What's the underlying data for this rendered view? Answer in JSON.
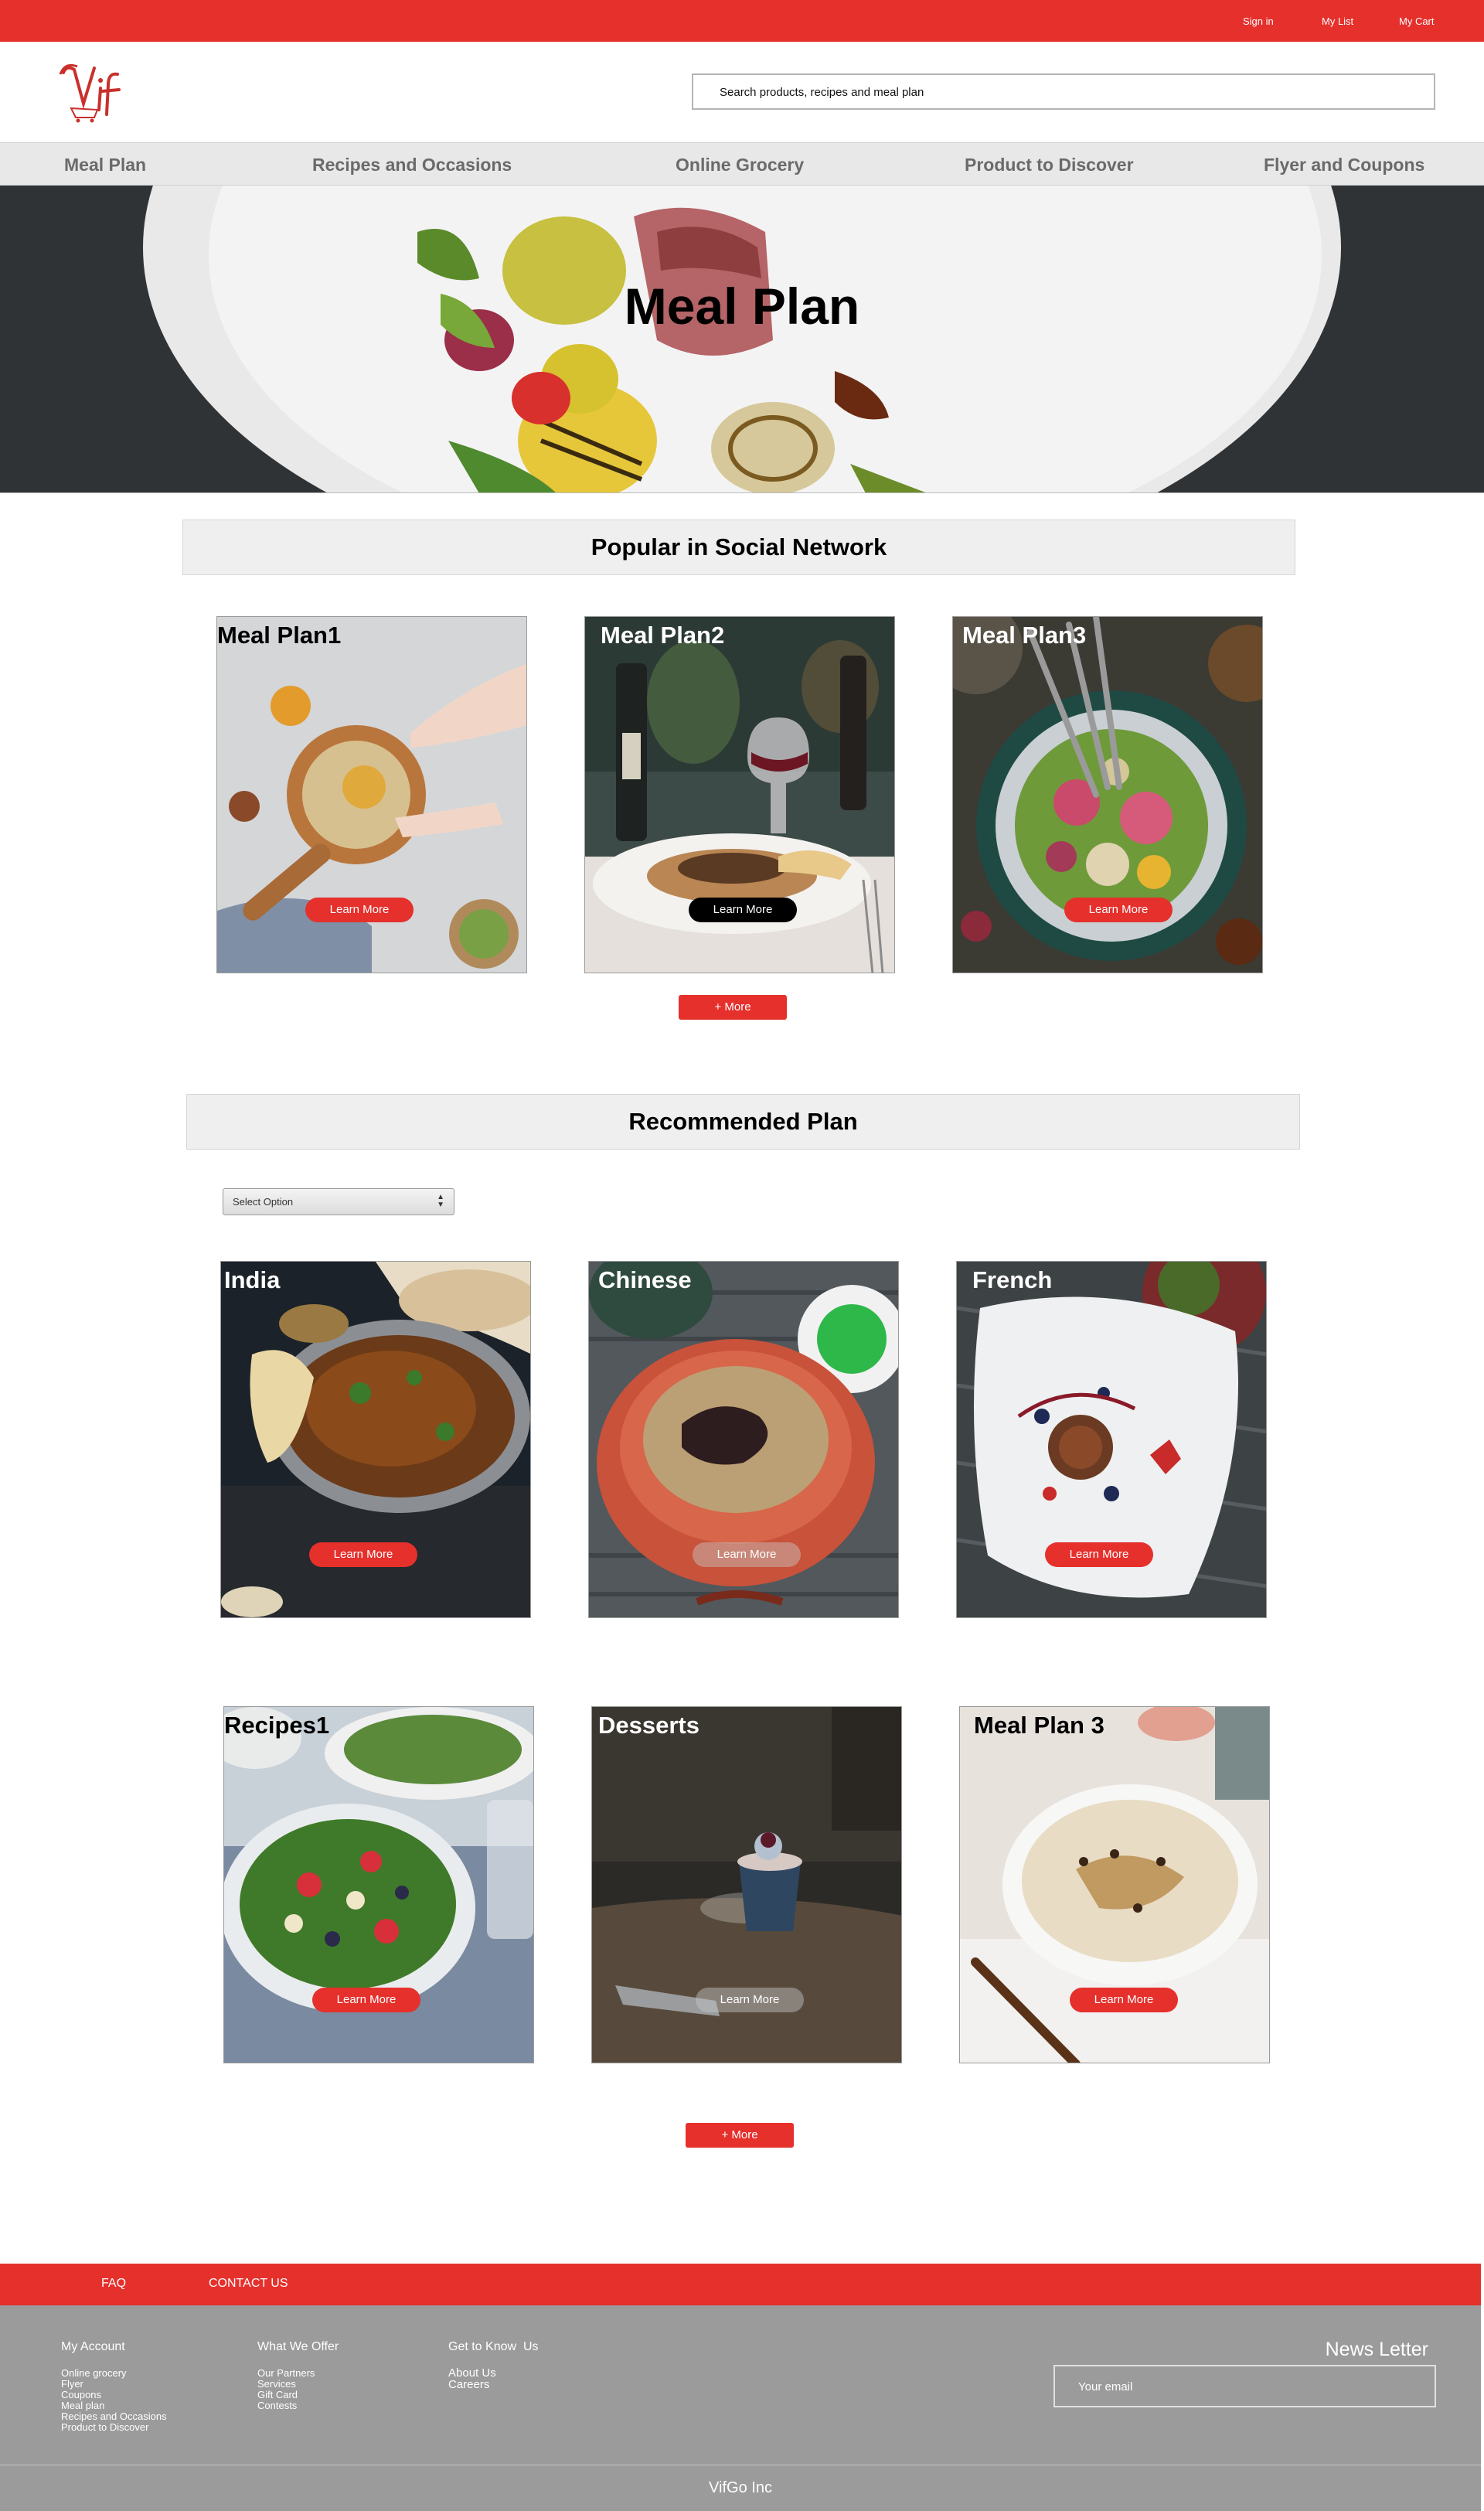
{
  "topbar": {
    "links": [
      "Sign in",
      "My List",
      "My Cart"
    ]
  },
  "brand": {
    "logo_text": "Vif"
  },
  "search": {
    "placeholder": "Search products, recipes and meal plan"
  },
  "nav": [
    "Meal Plan",
    "Recipes and Occasions",
    "Online Grocery",
    "Product to Discover",
    "Flyer and Coupons"
  ],
  "hero": {
    "title": "Meal Plan"
  },
  "popular": {
    "heading": "Popular in Social Network",
    "cards": [
      {
        "title": "Meal Plan1",
        "button": "Learn More"
      },
      {
        "title": "Meal Plan2",
        "button": "Learn More"
      },
      {
        "title": "Meal Plan3",
        "button": "Learn More"
      }
    ],
    "more_label": "+ More"
  },
  "recommended": {
    "heading": "Recommended Plan",
    "select_label": "Select Option",
    "cards": [
      {
        "title": "India",
        "button": "Learn More"
      },
      {
        "title": "Chinese",
        "button": "Learn More"
      },
      {
        "title": "French",
        "button": "Learn More"
      },
      {
        "title": "Recipes1",
        "button": "Learn More"
      },
      {
        "title": "Desserts",
        "button": "Learn More"
      },
      {
        "title": "Meal Plan 3",
        "button": "Learn More"
      }
    ],
    "more_label": "+ More"
  },
  "footer": {
    "top_links": [
      "FAQ",
      "CONTACT US"
    ],
    "columns": [
      {
        "title": "My Account",
        "items": [
          "Online grocery",
          "Flyer",
          "Coupons",
          "Meal plan",
          "Recipes and Occasions",
          "Product to Discover"
        ]
      },
      {
        "title": "What We Offer",
        "items": [
          "Our Partners",
          "Services",
          "Gift Card",
          "Contests"
        ]
      },
      {
        "title": "Get to Know  Us",
        "items": [
          "About Us",
          "Careers"
        ]
      }
    ],
    "newsletter_title": "News Letter",
    "email_placeholder": "Your email",
    "copyright": "VifGo Inc"
  },
  "colors": {
    "brand_red": "#e5302c",
    "footer_gray": "#9b9b9b",
    "nav_gray": "#e8e8e8",
    "nav_text": "#6a6a6a"
  }
}
